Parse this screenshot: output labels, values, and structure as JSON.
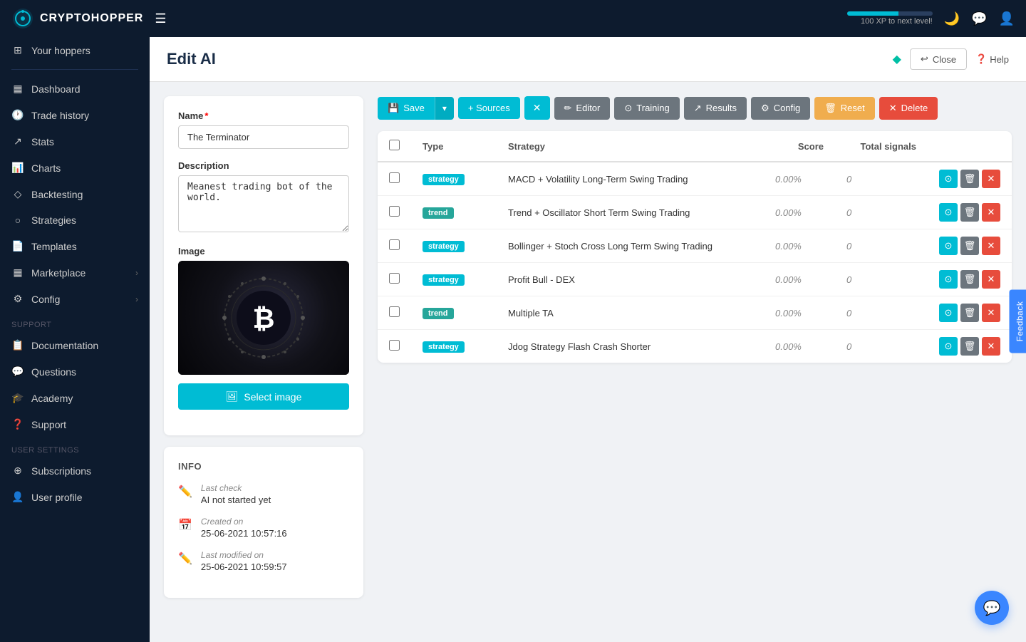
{
  "app": {
    "name": "CRYPTOHOPPER",
    "xp_label": "100 XP to next level!"
  },
  "topnav": {
    "menu_icon": "☰",
    "moon_icon": "🌙",
    "chat_icon": "💬",
    "user_icon": "👤"
  },
  "sidebar": {
    "sections": [
      {
        "items": [
          {
            "id": "your-hoppers",
            "label": "Your hoppers",
            "icon": "⊞"
          },
          {
            "divider": true
          },
          {
            "id": "dashboard",
            "label": "Dashboard",
            "icon": "⊟"
          },
          {
            "id": "trade-history",
            "label": "Trade history",
            "icon": "🕐"
          },
          {
            "id": "stats",
            "label": "Stats",
            "icon": "📈"
          },
          {
            "id": "charts",
            "label": "Charts",
            "icon": "📊"
          },
          {
            "id": "backtesting",
            "label": "Backtesting",
            "icon": "◇"
          },
          {
            "id": "strategies",
            "label": "Strategies",
            "icon": "○"
          },
          {
            "id": "templates",
            "label": "Templates",
            "icon": "📄"
          },
          {
            "id": "marketplace",
            "label": "Marketplace",
            "icon": "⊟",
            "arrow": true
          },
          {
            "id": "config",
            "label": "Config",
            "icon": "⚙",
            "arrow": true
          }
        ]
      },
      {
        "label": "SUPPORT",
        "items": [
          {
            "id": "documentation",
            "label": "Documentation",
            "icon": "📋"
          },
          {
            "id": "questions",
            "label": "Questions",
            "icon": "💬"
          },
          {
            "id": "academy",
            "label": "Academy",
            "icon": "🎓"
          },
          {
            "id": "support",
            "label": "Support",
            "icon": "❓"
          }
        ]
      },
      {
        "label": "USER SETTINGS",
        "items": [
          {
            "id": "subscriptions",
            "label": "Subscriptions",
            "icon": "⊕"
          },
          {
            "id": "user-profile",
            "label": "User profile",
            "icon": "👤"
          }
        ]
      }
    ]
  },
  "page": {
    "title": "Edit AI",
    "close_label": "Close",
    "help_label": "Help"
  },
  "left_panel": {
    "name_label": "Name",
    "name_value": "The Terminator",
    "description_label": "Description",
    "description_value": "Meanest trading bot of the world.",
    "image_label": "Image",
    "select_image_label": "Select image"
  },
  "info_panel": {
    "section_title": "INFO",
    "items": [
      {
        "label": "Last check",
        "value": "AI not started yet",
        "icon": "edit"
      },
      {
        "label": "Created on",
        "value": "25-06-2021 10:57:16",
        "icon": "calendar"
      },
      {
        "label": "Last modified on",
        "value": "25-06-2021 10:59:57",
        "icon": "edit"
      }
    ]
  },
  "toolbar": {
    "save_label": "Save",
    "sources_label": "+ Sources",
    "editor_label": "Editor",
    "training_label": "Training",
    "results_label": "Results",
    "config_label": "Config",
    "reset_label": "Reset",
    "delete_label": "Delete"
  },
  "table": {
    "columns": [
      "Type",
      "Strategy",
      "Score",
      "Total signals"
    ],
    "rows": [
      {
        "type": "strategy",
        "strategy": "MACD + Volatility Long-Term Swing Trading",
        "score": "0.00%",
        "total_signals": "0"
      },
      {
        "type": "trend",
        "strategy": "Trend + Oscillator Short Term Swing Trading",
        "score": "0.00%",
        "total_signals": "0"
      },
      {
        "type": "strategy",
        "strategy": "Bollinger + Stoch Cross Long Term Swing Trading",
        "score": "0.00%",
        "total_signals": "0"
      },
      {
        "type": "strategy",
        "strategy": "Profit Bull - DEX",
        "score": "0.00%",
        "total_signals": "0"
      },
      {
        "type": "trend",
        "strategy": "Multiple TA",
        "score": "0.00%",
        "total_signals": "0"
      },
      {
        "type": "strategy",
        "strategy": "Jdog Strategy Flash Crash Shorter",
        "score": "0.00%",
        "total_signals": "0"
      }
    ]
  },
  "feedback": {
    "label": "Feedback"
  },
  "chat": {
    "icon": "💬"
  }
}
